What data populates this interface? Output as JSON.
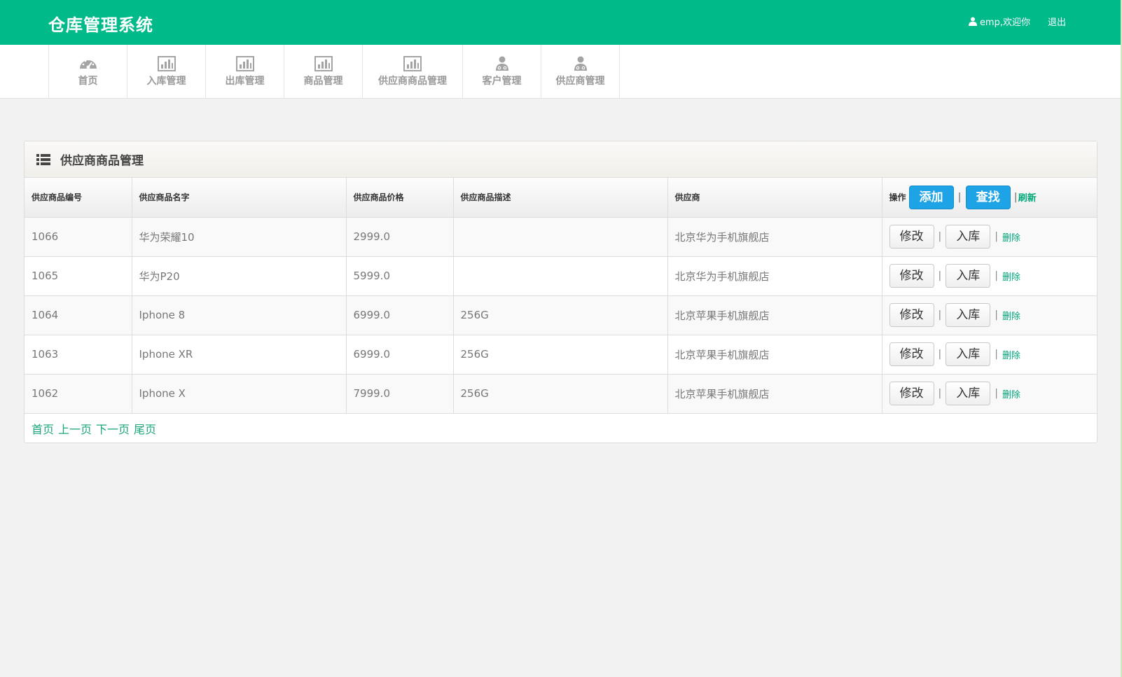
{
  "header": {
    "title": "仓库管理系统",
    "user_text": "emp,欢迎你",
    "logout": "退出",
    "bg_color": "#00ba8a"
  },
  "nav": {
    "items": [
      {
        "label": "首页",
        "icon": "dashboard-icon"
      },
      {
        "label": "入库管理",
        "icon": "bar-chart-icon"
      },
      {
        "label": "出库管理",
        "icon": "bar-chart-icon"
      },
      {
        "label": "商品管理",
        "icon": "bar-chart-icon"
      },
      {
        "label": "供应商商品管理",
        "icon": "bar-chart-icon"
      },
      {
        "label": "客户管理",
        "icon": "user-group-icon"
      },
      {
        "label": "供应商管理",
        "icon": "user-group-icon"
      }
    ]
  },
  "panel": {
    "title": "供应商商品管理",
    "icon": "list-icon"
  },
  "table": {
    "columns": [
      "供应商品编号",
      "供应商品名字",
      "供应商品价格",
      "供应商品描述",
      "供应商"
    ],
    "ops_header": {
      "label": "操作",
      "add": "添加",
      "search": "查找",
      "refresh": "刷新"
    },
    "row_actions": {
      "edit": "修改",
      "stock_in": "入库",
      "delete": "删除"
    },
    "rows": [
      {
        "id": "1066",
        "name": "华为荣耀10",
        "price": "2999.0",
        "desc": "",
        "supplier": "北京华为手机旗舰店"
      },
      {
        "id": "1065",
        "name": "华为P20",
        "price": "5999.0",
        "desc": "",
        "supplier": "北京华为手机旗舰店"
      },
      {
        "id": "1064",
        "name": "Iphone 8",
        "price": "6999.0",
        "desc": "256G",
        "supplier": "北京苹果手机旗舰店"
      },
      {
        "id": "1063",
        "name": "Iphone XR",
        "price": "6999.0",
        "desc": "256G",
        "supplier": "北京苹果手机旗舰店"
      },
      {
        "id": "1062",
        "name": "Iphone X",
        "price": "7999.0",
        "desc": "256G",
        "supplier": "北京苹果手机旗舰店"
      }
    ]
  },
  "pager": {
    "first": "首页",
    "prev": "上一页",
    "next": "下一页",
    "last": "尾页"
  }
}
